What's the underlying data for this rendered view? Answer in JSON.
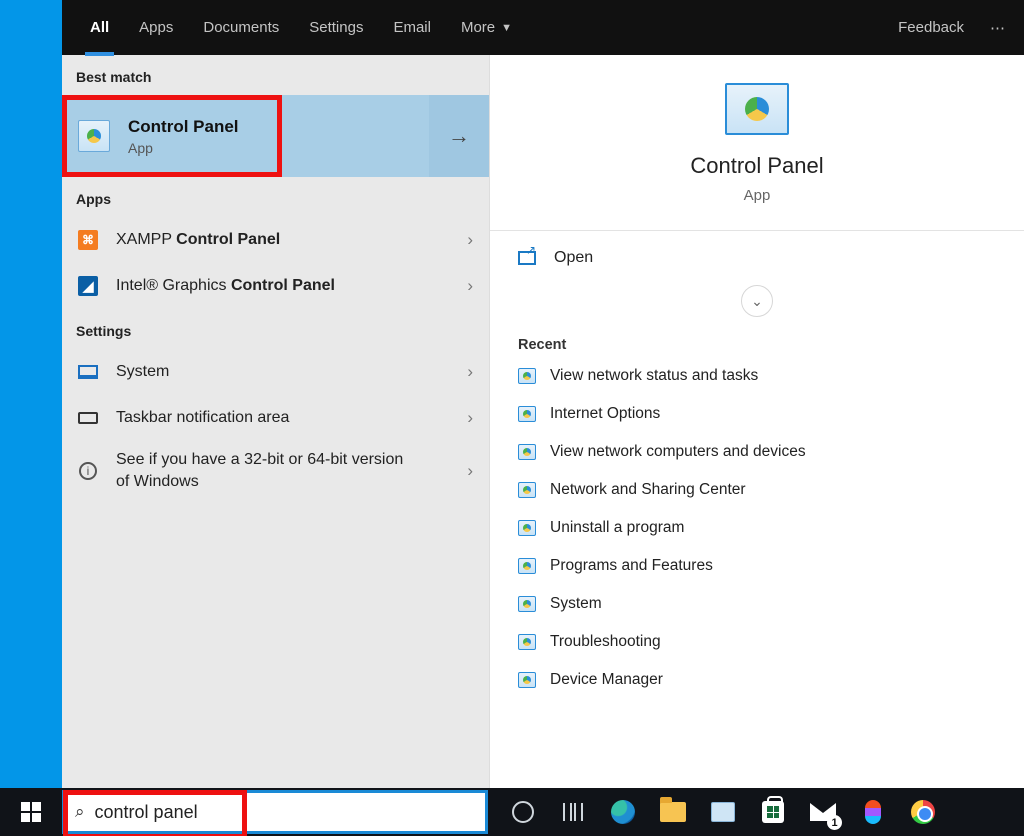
{
  "header": {
    "tabs": [
      "All",
      "Apps",
      "Documents",
      "Settings",
      "Email",
      "More"
    ],
    "active_tab": "All",
    "feedback": "Feedback",
    "more_menu": "⋯"
  },
  "left": {
    "best_match_label": "Best match",
    "best": {
      "title": "Control Panel",
      "subtitle": "App"
    },
    "apps_label": "Apps",
    "apps": [
      {
        "prefix": "XAMPP ",
        "bold": "Control Panel"
      },
      {
        "prefix": "Intel® Graphics ",
        "bold": "Control Panel"
      }
    ],
    "settings_label": "Settings",
    "settings": [
      "System",
      "Taskbar notification area",
      "See if you have a 32-bit or 64-bit version of Windows"
    ]
  },
  "preview": {
    "title": "Control Panel",
    "subtitle": "App",
    "open": "Open",
    "recent_label": "Recent",
    "recent": [
      "View network status and tasks",
      "Internet Options",
      "View network computers and devices",
      "Network and Sharing Center",
      "Uninstall a program",
      "Programs and Features",
      "System",
      "Troubleshooting",
      "Device Manager"
    ]
  },
  "taskbar": {
    "search_value": "control panel",
    "mail_badge": "1"
  }
}
